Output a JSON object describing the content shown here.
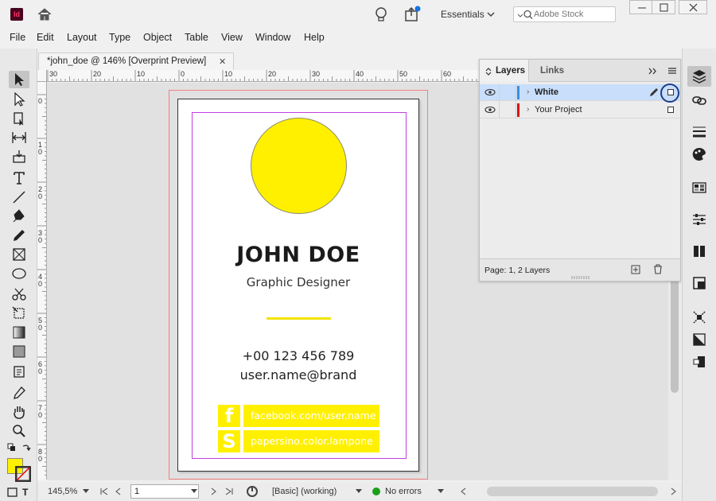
{
  "titlebar": {
    "app_badge": "Id",
    "workspace": "Essentials",
    "stock_placeholder": "Adobe Stock"
  },
  "menu": [
    "File",
    "Edit",
    "Layout",
    "Type",
    "Object",
    "Table",
    "View",
    "Window",
    "Help"
  ],
  "document": {
    "tab_title": "*john_doe @ 146% [Overprint Preview]",
    "close_glyph": "✕"
  },
  "rulers": {
    "horizontal": [
      "30",
      "20",
      "10",
      "0",
      "10",
      "20",
      "30",
      "40",
      "50",
      "60"
    ],
    "vertical": [
      "0",
      "1 0",
      "2 0",
      "3 0",
      "4 0",
      "5 0",
      "6 0",
      "7 0",
      "8 0"
    ]
  },
  "card": {
    "name": "JOHN DOE",
    "title": "Graphic Designer",
    "phone": "+00 123 456 789",
    "email": "user.name@brand",
    "social": [
      {
        "icon": "f",
        "text": "facebook.com/user.name"
      },
      {
        "icon": "S",
        "text": "papersino.color.lampone"
      }
    ],
    "accent_color": "#fff000"
  },
  "layers_panel": {
    "tabs": [
      "Layers",
      "Links"
    ],
    "layers": [
      {
        "name": "White",
        "color": "#3a8ee6",
        "selected": true
      },
      {
        "name": "Your Project",
        "color": "#e01010",
        "selected": false
      }
    ],
    "footer": "Page: 1, 2 Layers"
  },
  "statusbar": {
    "zoom": "145,5%",
    "page": "1",
    "style": "[Basic] (working)",
    "errors": "No errors"
  },
  "colors": {
    "fill_swatch": "#fff000",
    "error_ok": "#1aa01a"
  }
}
